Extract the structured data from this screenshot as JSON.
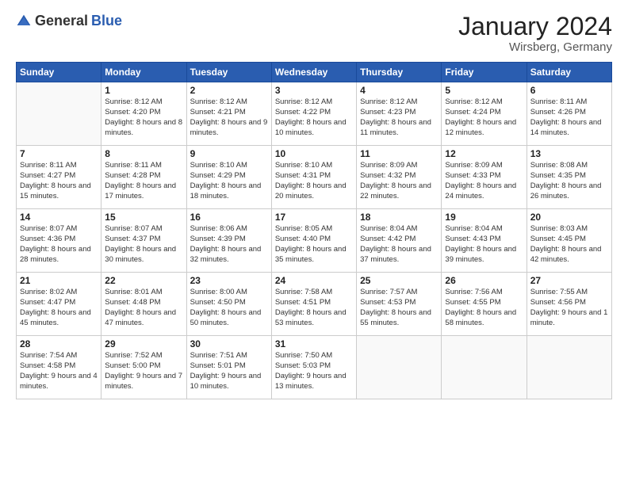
{
  "logo": {
    "general": "General",
    "blue": "Blue"
  },
  "header": {
    "month": "January 2024",
    "location": "Wirsberg, Germany"
  },
  "weekdays": [
    "Sunday",
    "Monday",
    "Tuesday",
    "Wednesday",
    "Thursday",
    "Friday",
    "Saturday"
  ],
  "weeks": [
    [
      {
        "day": "",
        "sunrise": "",
        "sunset": "",
        "daylight": ""
      },
      {
        "day": "1",
        "sunrise": "Sunrise: 8:12 AM",
        "sunset": "Sunset: 4:20 PM",
        "daylight": "Daylight: 8 hours and 8 minutes."
      },
      {
        "day": "2",
        "sunrise": "Sunrise: 8:12 AM",
        "sunset": "Sunset: 4:21 PM",
        "daylight": "Daylight: 8 hours and 9 minutes."
      },
      {
        "day": "3",
        "sunrise": "Sunrise: 8:12 AM",
        "sunset": "Sunset: 4:22 PM",
        "daylight": "Daylight: 8 hours and 10 minutes."
      },
      {
        "day": "4",
        "sunrise": "Sunrise: 8:12 AM",
        "sunset": "Sunset: 4:23 PM",
        "daylight": "Daylight: 8 hours and 11 minutes."
      },
      {
        "day": "5",
        "sunrise": "Sunrise: 8:12 AM",
        "sunset": "Sunset: 4:24 PM",
        "daylight": "Daylight: 8 hours and 12 minutes."
      },
      {
        "day": "6",
        "sunrise": "Sunrise: 8:11 AM",
        "sunset": "Sunset: 4:26 PM",
        "daylight": "Daylight: 8 hours and 14 minutes."
      }
    ],
    [
      {
        "day": "7",
        "sunrise": "Sunrise: 8:11 AM",
        "sunset": "Sunset: 4:27 PM",
        "daylight": "Daylight: 8 hours and 15 minutes."
      },
      {
        "day": "8",
        "sunrise": "Sunrise: 8:11 AM",
        "sunset": "Sunset: 4:28 PM",
        "daylight": "Daylight: 8 hours and 17 minutes."
      },
      {
        "day": "9",
        "sunrise": "Sunrise: 8:10 AM",
        "sunset": "Sunset: 4:29 PM",
        "daylight": "Daylight: 8 hours and 18 minutes."
      },
      {
        "day": "10",
        "sunrise": "Sunrise: 8:10 AM",
        "sunset": "Sunset: 4:31 PM",
        "daylight": "Daylight: 8 hours and 20 minutes."
      },
      {
        "day": "11",
        "sunrise": "Sunrise: 8:09 AM",
        "sunset": "Sunset: 4:32 PM",
        "daylight": "Daylight: 8 hours and 22 minutes."
      },
      {
        "day": "12",
        "sunrise": "Sunrise: 8:09 AM",
        "sunset": "Sunset: 4:33 PM",
        "daylight": "Daylight: 8 hours and 24 minutes."
      },
      {
        "day": "13",
        "sunrise": "Sunrise: 8:08 AM",
        "sunset": "Sunset: 4:35 PM",
        "daylight": "Daylight: 8 hours and 26 minutes."
      }
    ],
    [
      {
        "day": "14",
        "sunrise": "Sunrise: 8:07 AM",
        "sunset": "Sunset: 4:36 PM",
        "daylight": "Daylight: 8 hours and 28 minutes."
      },
      {
        "day": "15",
        "sunrise": "Sunrise: 8:07 AM",
        "sunset": "Sunset: 4:37 PM",
        "daylight": "Daylight: 8 hours and 30 minutes."
      },
      {
        "day": "16",
        "sunrise": "Sunrise: 8:06 AM",
        "sunset": "Sunset: 4:39 PM",
        "daylight": "Daylight: 8 hours and 32 minutes."
      },
      {
        "day": "17",
        "sunrise": "Sunrise: 8:05 AM",
        "sunset": "Sunset: 4:40 PM",
        "daylight": "Daylight: 8 hours and 35 minutes."
      },
      {
        "day": "18",
        "sunrise": "Sunrise: 8:04 AM",
        "sunset": "Sunset: 4:42 PM",
        "daylight": "Daylight: 8 hours and 37 minutes."
      },
      {
        "day": "19",
        "sunrise": "Sunrise: 8:04 AM",
        "sunset": "Sunset: 4:43 PM",
        "daylight": "Daylight: 8 hours and 39 minutes."
      },
      {
        "day": "20",
        "sunrise": "Sunrise: 8:03 AM",
        "sunset": "Sunset: 4:45 PM",
        "daylight": "Daylight: 8 hours and 42 minutes."
      }
    ],
    [
      {
        "day": "21",
        "sunrise": "Sunrise: 8:02 AM",
        "sunset": "Sunset: 4:47 PM",
        "daylight": "Daylight: 8 hours and 45 minutes."
      },
      {
        "day": "22",
        "sunrise": "Sunrise: 8:01 AM",
        "sunset": "Sunset: 4:48 PM",
        "daylight": "Daylight: 8 hours and 47 minutes."
      },
      {
        "day": "23",
        "sunrise": "Sunrise: 8:00 AM",
        "sunset": "Sunset: 4:50 PM",
        "daylight": "Daylight: 8 hours and 50 minutes."
      },
      {
        "day": "24",
        "sunrise": "Sunrise: 7:58 AM",
        "sunset": "Sunset: 4:51 PM",
        "daylight": "Daylight: 8 hours and 53 minutes."
      },
      {
        "day": "25",
        "sunrise": "Sunrise: 7:57 AM",
        "sunset": "Sunset: 4:53 PM",
        "daylight": "Daylight: 8 hours and 55 minutes."
      },
      {
        "day": "26",
        "sunrise": "Sunrise: 7:56 AM",
        "sunset": "Sunset: 4:55 PM",
        "daylight": "Daylight: 8 hours and 58 minutes."
      },
      {
        "day": "27",
        "sunrise": "Sunrise: 7:55 AM",
        "sunset": "Sunset: 4:56 PM",
        "daylight": "Daylight: 9 hours and 1 minute."
      }
    ],
    [
      {
        "day": "28",
        "sunrise": "Sunrise: 7:54 AM",
        "sunset": "Sunset: 4:58 PM",
        "daylight": "Daylight: 9 hours and 4 minutes."
      },
      {
        "day": "29",
        "sunrise": "Sunrise: 7:52 AM",
        "sunset": "Sunset: 5:00 PM",
        "daylight": "Daylight: 9 hours and 7 minutes."
      },
      {
        "day": "30",
        "sunrise": "Sunrise: 7:51 AM",
        "sunset": "Sunset: 5:01 PM",
        "daylight": "Daylight: 9 hours and 10 minutes."
      },
      {
        "day": "31",
        "sunrise": "Sunrise: 7:50 AM",
        "sunset": "Sunset: 5:03 PM",
        "daylight": "Daylight: 9 hours and 13 minutes."
      },
      {
        "day": "",
        "sunrise": "",
        "sunset": "",
        "daylight": ""
      },
      {
        "day": "",
        "sunrise": "",
        "sunset": "",
        "daylight": ""
      },
      {
        "day": "",
        "sunrise": "",
        "sunset": "",
        "daylight": ""
      }
    ]
  ]
}
